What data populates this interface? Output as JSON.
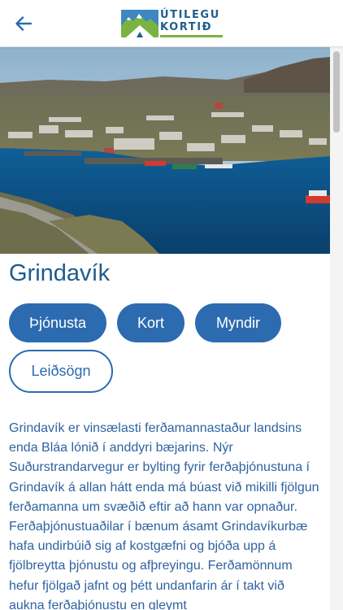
{
  "header": {
    "back_icon": "arrow-left-icon",
    "logo": {
      "line1": "ÚTILEGU",
      "line2": "KORTIÐ"
    }
  },
  "place": {
    "name": "Grindavík",
    "image_alt": "Grindavík"
  },
  "buttons": [
    {
      "label": "Þjónusta",
      "style": "filled"
    },
    {
      "label": "Kort",
      "style": "filled"
    },
    {
      "label": "Myndir",
      "style": "filled"
    },
    {
      "label": "Leiðsögn",
      "style": "outline"
    }
  ],
  "description": "Grindavík er vinsælasti ferðamannastaður landsins enda Bláa lónið í anddyri bæjarins. Nýr Suðurstrandarvegur er bylting fyrir ferðaþjónustuna í Grindavík á allan hátt enda má búast við mikilli fjölgun ferðamanna um svæðið eftir að hann var opnaður. Ferðaþjónustuaðilar í bænum ásamt Grindavíkurbæ hafa undirbúið sig af kostgæfni og bjóða upp á fjölbreytta þjónustu og afþreyingu. Ferðamönnum hefur fjölgað jafnt og þétt undanfarin ár í takt við aukna ferðaþjónustu en gleymt",
  "colors": {
    "primary": "#2c6bb0",
    "title": "#1f5b8d",
    "logo_blue": "#1f5f8e",
    "logo_green": "#7bb342"
  }
}
